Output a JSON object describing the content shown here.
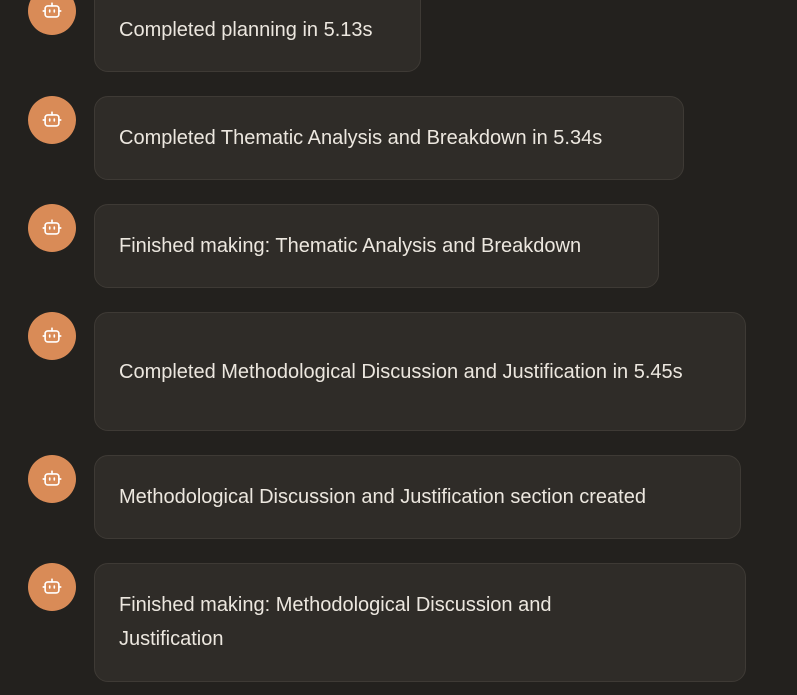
{
  "messages": [
    {
      "text": "Completed planning in 5.13s",
      "avatar_icon": "robot-icon"
    },
    {
      "text": "Completed Thematic Analysis and Breakdown in 5.34s",
      "avatar_icon": "robot-icon"
    },
    {
      "text": "Finished making: Thematic Analysis and Breakdown",
      "avatar_icon": "robot-icon"
    },
    {
      "text": "Completed Methodological Discussion and Justification in 5.45s",
      "avatar_icon": "robot-icon"
    },
    {
      "text": "Methodological Discussion and Justification section created",
      "avatar_icon": "robot-icon"
    },
    {
      "text": "Finished making: Methodological Discussion and Justification",
      "avatar_icon": "robot-icon"
    }
  ],
  "colors": {
    "background": "#23211e",
    "bubble": "#2f2c28",
    "bubble_border": "#3e3a35",
    "avatar": "#d98b57",
    "text": "#ece7df"
  }
}
